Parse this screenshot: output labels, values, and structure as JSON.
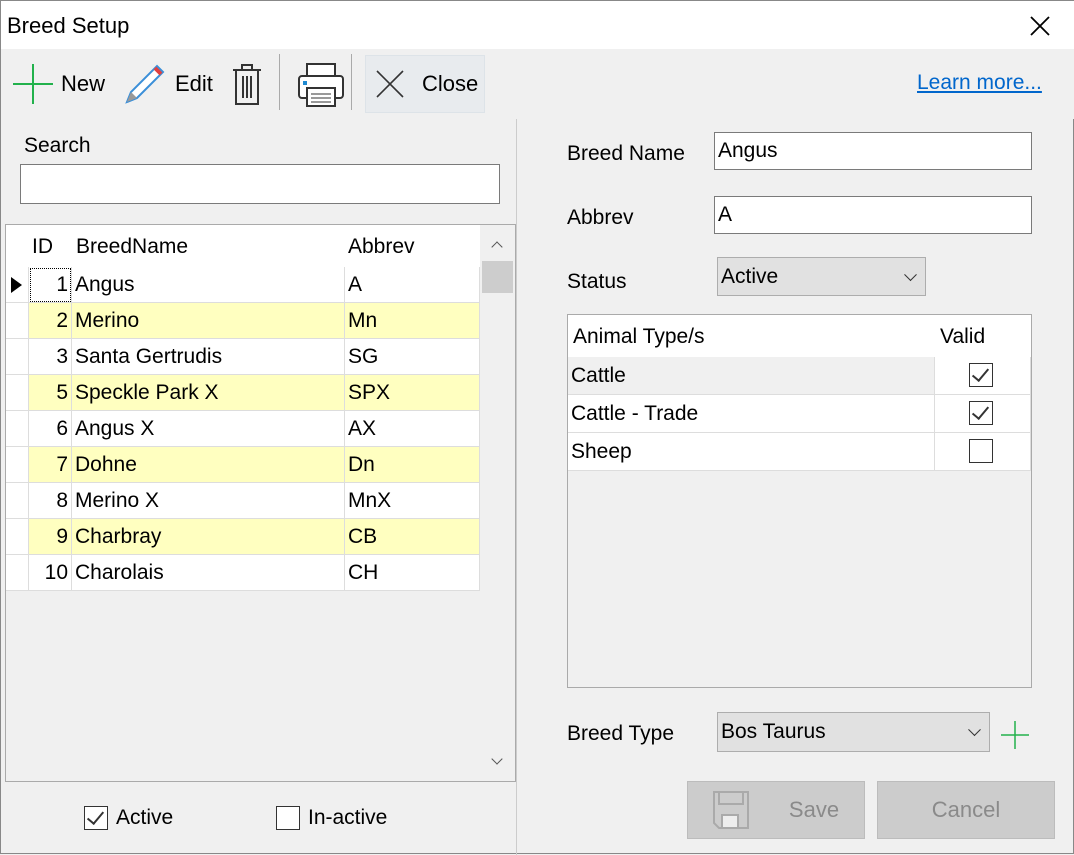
{
  "window": {
    "title": "Breed Setup"
  },
  "toolbar": {
    "new": "New",
    "edit": "Edit",
    "close": "Close",
    "learn_more": "Learn more..."
  },
  "search": {
    "label": "Search",
    "value": ""
  },
  "grid": {
    "columns": [
      "ID",
      "BreedName",
      "Abbrev"
    ],
    "rows": [
      {
        "id": "1",
        "name": "Angus",
        "abbrev": "A"
      },
      {
        "id": "2",
        "name": "Merino",
        "abbrev": "Mn"
      },
      {
        "id": "3",
        "name": "Santa Gertrudis",
        "abbrev": "SG"
      },
      {
        "id": "5",
        "name": "Speckle Park X",
        "abbrev": "SPX"
      },
      {
        "id": "6",
        "name": "Angus X",
        "abbrev": "AX"
      },
      {
        "id": "7",
        "name": "Dohne",
        "abbrev": "Dn"
      },
      {
        "id": "8",
        "name": "Merino X",
        "abbrev": "MnX"
      },
      {
        "id": "9",
        "name": "Charbray",
        "abbrev": "CB"
      },
      {
        "id": "10",
        "name": "Charolais",
        "abbrev": "CH"
      }
    ],
    "alt_row_color": "#ffffc0"
  },
  "filters": {
    "active": {
      "label": "Active",
      "checked": true
    },
    "inactive": {
      "label": "In-active",
      "checked": false
    }
  },
  "form": {
    "breed_name_label": "Breed Name",
    "breed_name": "Angus",
    "abbrev_label": "Abbrev",
    "abbrev": "A",
    "status_label": "Status",
    "status": "Active",
    "animal_types": {
      "col_type": "Animal Type/s",
      "col_valid": "Valid",
      "rows": [
        {
          "type": "Cattle",
          "valid": true
        },
        {
          "type": "Cattle - Trade",
          "valid": true
        },
        {
          "type": "Sheep",
          "valid": false
        }
      ]
    },
    "breed_type_label": "Breed Type",
    "breed_type": "Bos Taurus",
    "save": "Save",
    "cancel": "Cancel"
  }
}
